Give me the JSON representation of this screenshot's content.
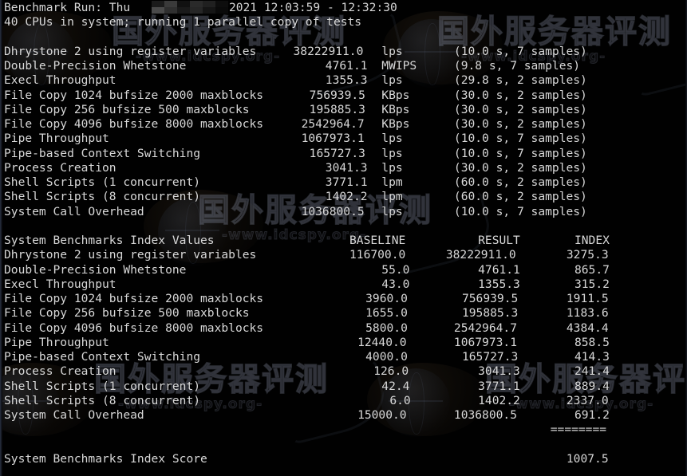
{
  "terminal": {
    "header": {
      "line1_prefix": "Benchmark Run: Thu",
      "redacted_label": "redacted-date",
      "line1_suffix": "2021 12:03:59 - 12:32:30",
      "line2": "40 CPUs in system; running 1 parallel copy of tests"
    },
    "watermark": {
      "chinese": "国外服务器评测",
      "url": "-www.idcspy.org-"
    },
    "results_section": {
      "rows": [
        {
          "name": "Dhrystone 2 using register variables",
          "value": "38222911.0",
          "unit": "lps",
          "detail": "(10.0 s, 7 samples)"
        },
        {
          "name": "Double-Precision Whetstone",
          "value": "4761.1",
          "unit": "MWIPS",
          "detail": "(9.8 s, 7 samples)"
        },
        {
          "name": "Execl Throughput",
          "value": "1355.3",
          "unit": "lps",
          "detail": "(29.8 s, 2 samples)"
        },
        {
          "name": "File Copy 1024 bufsize 2000 maxblocks",
          "value": "756939.5",
          "unit": "KBps",
          "detail": "(30.0 s, 2 samples)"
        },
        {
          "name": "File Copy 256 bufsize 500 maxblocks",
          "value": "195885.3",
          "unit": "KBps",
          "detail": "(30.0 s, 2 samples)"
        },
        {
          "name": "File Copy 4096 bufsize 8000 maxblocks",
          "value": "2542964.7",
          "unit": "KBps",
          "detail": "(30.0 s, 2 samples)"
        },
        {
          "name": "Pipe Throughput",
          "value": "1067973.1",
          "unit": "lps",
          "detail": "(10.0 s, 7 samples)"
        },
        {
          "name": "Pipe-based Context Switching",
          "value": "165727.3",
          "unit": "lps",
          "detail": "(10.0 s, 7 samples)"
        },
        {
          "name": "Process Creation",
          "value": "3041.3",
          "unit": "lps",
          "detail": "(30.0 s, 2 samples)"
        },
        {
          "name": "Shell Scripts (1 concurrent)",
          "value": "3771.1",
          "unit": "lpm",
          "detail": "(60.0 s, 2 samples)"
        },
        {
          "name": "Shell Scripts (8 concurrent)",
          "value": "1402.2",
          "unit": "lpm",
          "detail": "(60.0 s, 2 samples)"
        },
        {
          "name": "System Call Overhead",
          "value": "1036800.5",
          "unit": "lps",
          "detail": "(10.0 s, 7 samples)"
        }
      ]
    },
    "index_section": {
      "title": "System Benchmarks Index Values",
      "columns": [
        "BASELINE",
        "RESULT",
        "INDEX"
      ],
      "rows": [
        {
          "name": "Dhrystone 2 using register variables",
          "baseline": "116700.0",
          "result": "38222911.0",
          "index": "3275.3"
        },
        {
          "name": "Double-Precision Whetstone",
          "baseline": "55.0",
          "result": "4761.1",
          "index": "865.7"
        },
        {
          "name": "Execl Throughput",
          "baseline": "43.0",
          "result": "1355.3",
          "index": "315.2"
        },
        {
          "name": "File Copy 1024 bufsize 2000 maxblocks",
          "baseline": "3960.0",
          "result": "756939.5",
          "index": "1911.5"
        },
        {
          "name": "File Copy 256 bufsize 500 maxblocks",
          "baseline": "1655.0",
          "result": "195885.3",
          "index": "1183.6"
        },
        {
          "name": "File Copy 4096 bufsize 8000 maxblocks",
          "baseline": "5800.0",
          "result": "2542964.7",
          "index": "4384.4"
        },
        {
          "name": "Pipe Throughput",
          "baseline": "12440.0",
          "result": "1067973.1",
          "index": "858.5"
        },
        {
          "name": "Pipe-based Context Switching",
          "baseline": "4000.0",
          "result": "165727.3",
          "index": "414.3"
        },
        {
          "name": "Process Creation",
          "baseline": "126.0",
          "result": "3041.3",
          "index": "241.4"
        },
        {
          "name": "Shell Scripts (1 concurrent)",
          "baseline": "42.4",
          "result": "3771.1",
          "index": "889.4"
        },
        {
          "name": "Shell Scripts (8 concurrent)",
          "baseline": "6.0",
          "result": "1402.2",
          "index": "2337.0"
        },
        {
          "name": "System Call Overhead",
          "baseline": "15000.0",
          "result": "1036800.5",
          "index": "691.2"
        }
      ],
      "separator": "========",
      "score_label": "System Benchmarks Index Score",
      "score_value": "1007.5"
    },
    "colors": {
      "background": "#010101",
      "text": "#d8d8d8",
      "watermark": "#8f9ab9"
    }
  }
}
